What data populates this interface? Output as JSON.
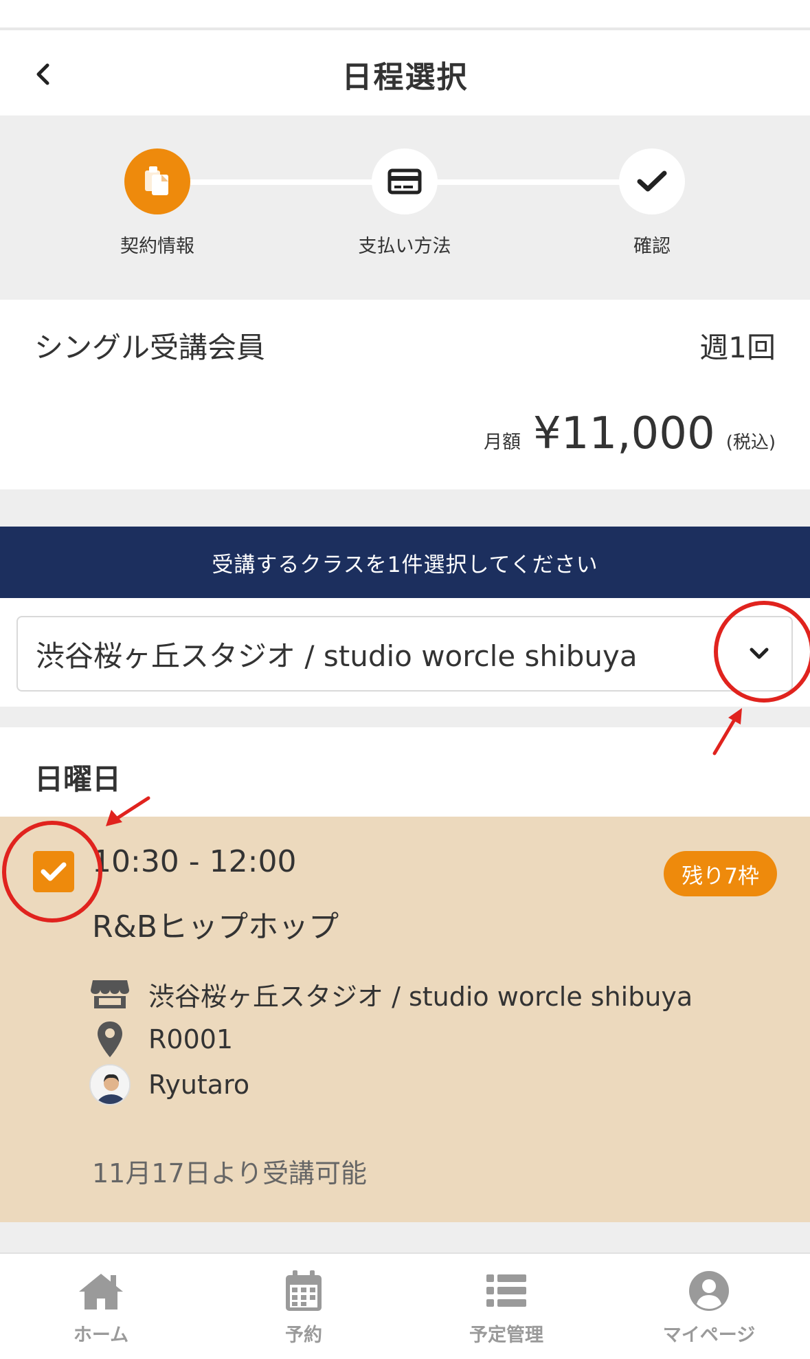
{
  "header": {
    "title": "日程選択"
  },
  "steps": [
    {
      "label": "契約情報",
      "icon": "clipboard-icon",
      "active": true
    },
    {
      "label": "支払い方法",
      "icon": "credit-card-icon",
      "active": false
    },
    {
      "label": "確認",
      "icon": "check-icon",
      "active": false
    }
  ],
  "plan": {
    "name": "シングル受講会員",
    "frequency": "週1回",
    "price_label": "月額",
    "price": "¥11,000",
    "tax_note": "(税込)"
  },
  "banner": {
    "text": "受講するクラスを1件選択してください"
  },
  "studio_select": {
    "value": "渋谷桜ヶ丘スタジオ / studio worcle shibuya"
  },
  "day": {
    "title": "日曜日"
  },
  "class_item": {
    "checked": true,
    "time": "10:30 - 12:00",
    "name": "R&Bヒップホップ",
    "remaining": "残り7枠",
    "studio": "渋谷桜ヶ丘スタジオ / studio worcle shibuya",
    "room": "R0001",
    "instructor": "Ryutaro",
    "available_from": "11月17日より受講可能"
  },
  "tabbar": [
    {
      "label": "ホーム",
      "icon": "home-icon"
    },
    {
      "label": "予約",
      "icon": "calendar-icon"
    },
    {
      "label": "予定管理",
      "icon": "list-icon"
    },
    {
      "label": "マイページ",
      "icon": "user-icon"
    }
  ],
  "colors": {
    "accent": "#ee8a0c",
    "banner": "#1c2f5e",
    "card_bg": "#ecd9bd",
    "annotation": "#e0231e"
  }
}
